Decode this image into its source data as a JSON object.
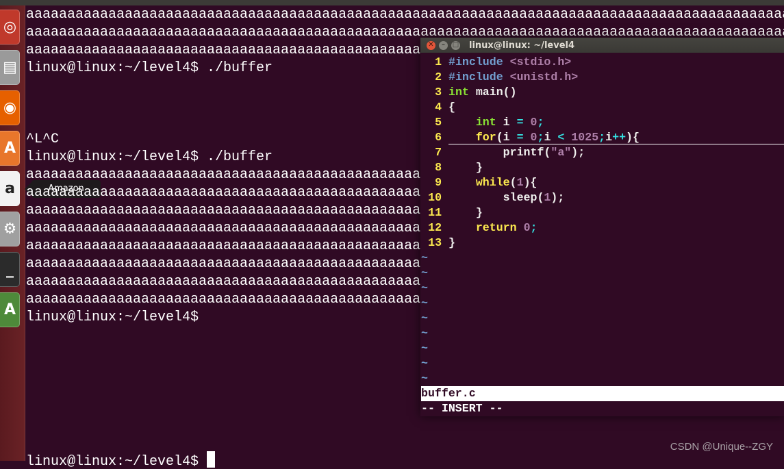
{
  "launcher": {
    "items": [
      {
        "name": "ubuntu-dash",
        "glyph": "◎",
        "color": "#c0392b"
      },
      {
        "name": "files",
        "glyph": "▤",
        "color": "#9a9a9a"
      },
      {
        "name": "firefox",
        "glyph": "◉",
        "color": "#e66000"
      },
      {
        "name": "software-center",
        "glyph": "A",
        "color": "#e8762b"
      },
      {
        "name": "amazon",
        "glyph": "a",
        "color": "#f2f2f2"
      },
      {
        "name": "system-settings",
        "glyph": "⚙",
        "color": "#a0a0a0"
      },
      {
        "name": "terminal",
        "glyph": "_",
        "color": "#2b2b2b"
      },
      {
        "name": "software-updater",
        "glyph": "A",
        "color": "#4e8a3a"
      }
    ],
    "tooltip": "Amazon"
  },
  "terminal": {
    "lines": [
      "aaaaaaaaaaaaaaaaaaaaaaaaaaaaaaaaaaaaaaaaaaaaaaaaaaaaaaaaaaaaaaaaaaaaaaaaaaaaaaaaaaaaaaaaaaaaaaaaa",
      "aaaaaaaaaaaaaaaaaaaaaaaaaaaaaaaaaaaaaaaaaaaaaaaaaaaaaaaaaaaaaaaaaaaaaaaaaaaaaaaaaaaaaaaaaaaaaaaaa",
      "aaaaaaaaaaaaaaaaaaaaaaaaaaaaaaaaaaaaaaaaaaaaaaaaaaaaaaaaaaaaaaaaaaaaaaaaaaaaaaaaaaaaaaaaaaaaaaaaa",
      "linux@linux:~/level4$ ./buffer",
      "",
      "",
      "",
      "^L^C",
      "linux@linux:~/level4$ ./buffer",
      "aaaaaaaaaaaaaaaaaaaaaaaaaaaaaaaaaaaaaaaaaaaaaaaaaaa",
      "aaaaaaaaaaaaaaaaaaaaaaaaaaaaaaaaaaaaaaaaaaaaaaaaaaa",
      "aaaaaaaaaaaaaaaaaaaaaaaaaaaaaaaaaaaaaaaaaaaaaaaaaaa",
      "aaaaaaaaaaaaaaaaaaaaaaaaaaaaaaaaaaaaaaaaaaaaaaaaaaa",
      "aaaaaaaaaaaaaaaaaaaaaaaaaaaaaaaaaaaaaaaaaaaaaaaaaaa",
      "aaaaaaaaaaaaaaaaaaaaaaaaaaaaaaaaaaaaaaaaaaaaaaaaaaa",
      "aaaaaaaaaaaaaaaaaaaaaaaaaaaaaaaaaaaaaaaaaaaaaaaaaaa",
      "aaaaaaaaaaaaaaaaaaaaaaaaaaaaaaaaaaaaaaaaaaaaaaaaaaa",
      "linux@linux:~/level4$",
      "",
      "",
      "",
      "",
      "",
      "",
      "",
      "linux@linux:~/level4$ "
    ]
  },
  "vim": {
    "title": "linux@linux: ~/level4",
    "code": [
      [
        [
          "pp",
          "#include"
        ],
        [
          "txt",
          " "
        ],
        [
          "inc",
          "<stdio.h>"
        ]
      ],
      [
        [
          "pp",
          "#include"
        ],
        [
          "txt",
          " "
        ],
        [
          "inc",
          "<unistd.h>"
        ]
      ],
      [
        [
          "ty",
          "int"
        ],
        [
          "txt",
          " main()"
        ]
      ],
      [
        [
          "txt",
          "{"
        ]
      ],
      [
        [
          "txt",
          "    "
        ],
        [
          "ty",
          "int"
        ],
        [
          "txt",
          " i "
        ],
        [
          "op",
          "="
        ],
        [
          "txt",
          " "
        ],
        [
          "num",
          "0"
        ],
        [
          "op",
          ";"
        ]
      ],
      [
        [
          "txt",
          "    "
        ],
        [
          "kw",
          "for"
        ],
        [
          "txt",
          "(i "
        ],
        [
          "op",
          "="
        ],
        [
          "txt",
          " "
        ],
        [
          "num",
          "0"
        ],
        [
          "op",
          ";"
        ],
        [
          "txt",
          "i "
        ],
        [
          "op",
          "<"
        ],
        [
          "txt",
          " "
        ],
        [
          "num",
          "1025"
        ],
        [
          "op",
          ";"
        ],
        [
          "txt",
          "i"
        ],
        [
          "op",
          "++"
        ],
        [
          "txt",
          "){"
        ]
      ],
      [
        [
          "txt",
          "        printf("
        ],
        [
          "str",
          "\"a\""
        ],
        [
          "txt",
          ");"
        ]
      ],
      [
        [
          "txt",
          "    }"
        ]
      ],
      [
        [
          "txt",
          "    "
        ],
        [
          "kw",
          "while"
        ],
        [
          "txt",
          "("
        ],
        [
          "num",
          "1"
        ],
        [
          "txt",
          "){"
        ]
      ],
      [
        [
          "txt",
          "        sleep("
        ],
        [
          "num",
          "1"
        ],
        [
          "txt",
          ");"
        ]
      ],
      [
        [
          "txt",
          "    }"
        ]
      ],
      [
        [
          "txt",
          "    "
        ],
        [
          "kw",
          "return"
        ],
        [
          "txt",
          " "
        ],
        [
          "num",
          "0"
        ],
        [
          "op",
          ";"
        ]
      ],
      [
        [
          "txt",
          "}"
        ]
      ]
    ],
    "cursor_line": 6,
    "empty_line_marker": "~",
    "empty_lines": 9,
    "status_filename": "buffer.c",
    "mode": "-- INSERT --"
  },
  "watermark": "CSDN @Unique--ZGY"
}
